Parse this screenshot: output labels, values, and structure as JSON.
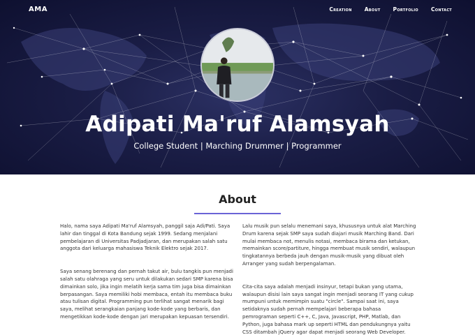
{
  "nav": {
    "brand": "AMA",
    "items": [
      "Creation",
      "About",
      "Portfolio",
      "Contact"
    ]
  },
  "hero": {
    "name": "Adipati Ma'ruf Alamsyah",
    "tagline": "College Student | Marching Drummer | Programmer"
  },
  "about": {
    "title": "About",
    "left": [
      "Halo, nama saya Adipati Ma'ruf Alamsyah, panggil saja Adi/Pati. Saya lahir dan tinggal di Kota Bandung sejak 1999. Sedang menjalani pembelajaran di Universitas Padjadjaran, dan merupakan salah satu anggota dari keluarga mahasiswa Teknik Elektro sejak 2017.",
      "Saya senang berenang dan pernah takut air, bulu tangkis pun menjadi salah satu olahraga yang seru untuk dilakukan sedari SMP karena bisa dimainkan solo, jika ingin melatih kerja sama tim juga bisa dimainkan berpasangan. Saya memiliki hobi membaca, entah itu membaca buku atau tulisan digital. Programming pun terlihat sangat menarik bagi saya, melihat serangkaian panjang kode-kode yang berbaris, dan mengetikkan kode-kode dengan jari merupakan kepuasan tersendiri."
    ],
    "right": [
      "Lalu musik pun selalu menemani saya, khususnya untuk alat Marching Drum karena sejak SMP saya sudah diajari musik Marching Band. Dari mulai membaca not, menulis notasi, membaca birama dan ketukan, memainkan score/partiture, hingga membuat musik sendiri, walaupun tingkatannya berbeda jauh dengan musik-musik yang dibuat oleh Arranger yang sudah berpengalaman.",
      "Cita-cita saya adalah menjadi insinyur, tetapi bukan yang utama, walaupun disisi lain saya sangat ingin menjadi seorang IT yang cukup mumpuni untuk memimpin suatu \"circle\". Sampai saat ini, saya setidaknya sudah pernah mempelajari beberapa bahasa pemrograman seperti C++, C, Java, Javascript, PHP, Matlab, dan Python, juga bahasa mark up seperti HTML dan pendukungnya yaitu CSS ditambah jQuery agar dapat menjadi seorang Web Developer."
    ]
  },
  "colors": {
    "hero_bg": "#1a1d45",
    "accent_rule": "#6a63d6",
    "text": "#333333"
  }
}
